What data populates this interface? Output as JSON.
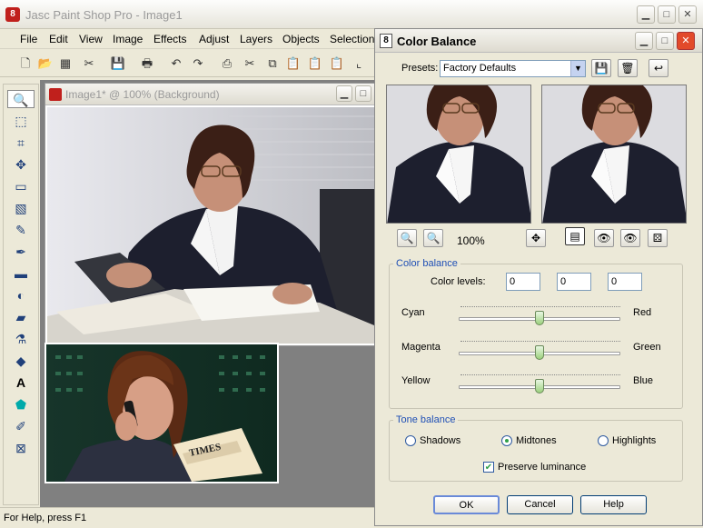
{
  "app": {
    "title": "Jasc Paint Shop Pro - Image1",
    "logo_text": "8"
  },
  "menu": [
    "File",
    "Edit",
    "View",
    "Image",
    "Effects",
    "Adjust",
    "Layers",
    "Objects",
    "Selections"
  ],
  "doc": {
    "title": "Image1* @ 100% (Background)"
  },
  "status": {
    "text": "For Help, press F1"
  },
  "dialog": {
    "icon_text": "8",
    "title": "Color Balance",
    "presets_label": "Presets:",
    "presets_value": "Factory Defaults",
    "zoom": "100%",
    "color_balance_group": "Color balance",
    "color_levels_label": "Color levels:",
    "levels": [
      "0",
      "0",
      "0"
    ],
    "sliders": [
      {
        "left": "Cyan",
        "right": "Red",
        "value": 0
      },
      {
        "left": "Magenta",
        "right": "Green",
        "value": 0
      },
      {
        "left": "Yellow",
        "right": "Blue",
        "value": 0
      }
    ],
    "tone_group": "Tone balance",
    "tones": [
      {
        "label": "Shadows",
        "selected": false
      },
      {
        "label": "Midtones",
        "selected": true
      },
      {
        "label": "Highlights",
        "selected": false
      }
    ],
    "preserve_label": "Preserve luminance",
    "preserve_checked": true,
    "ok_label": "OK",
    "cancel_label": "Cancel",
    "help_label": "Help"
  },
  "newspaper_text": "TIMES",
  "colors": {
    "accent": "#1f4fb5",
    "title_text": "#9a9a9a",
    "close": "#e24a2a"
  }
}
